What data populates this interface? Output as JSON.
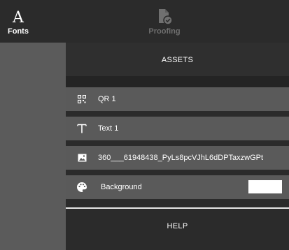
{
  "toolbar": {
    "fonts_label": "Fonts",
    "proofing_label": "Proofing"
  },
  "assets": {
    "header": "ASSETS",
    "items": [
      {
        "label": "QR 1",
        "icon": "qr-code-icon"
      },
      {
        "label": "Text 1",
        "icon": "text-icon"
      },
      {
        "label": "360___61948438_PyLs8pcVJhL6dDPTaxzwGPt",
        "icon": "image-icon"
      }
    ],
    "background": {
      "label": "Background",
      "icon": "palette-icon",
      "color": "#ffffff"
    }
  },
  "help": {
    "header": "HELP"
  },
  "colors": {
    "panel_bg": "#2b2b2b",
    "row_bg": "#5a5a5a",
    "sidebar_bg": "#5b5b5b"
  }
}
